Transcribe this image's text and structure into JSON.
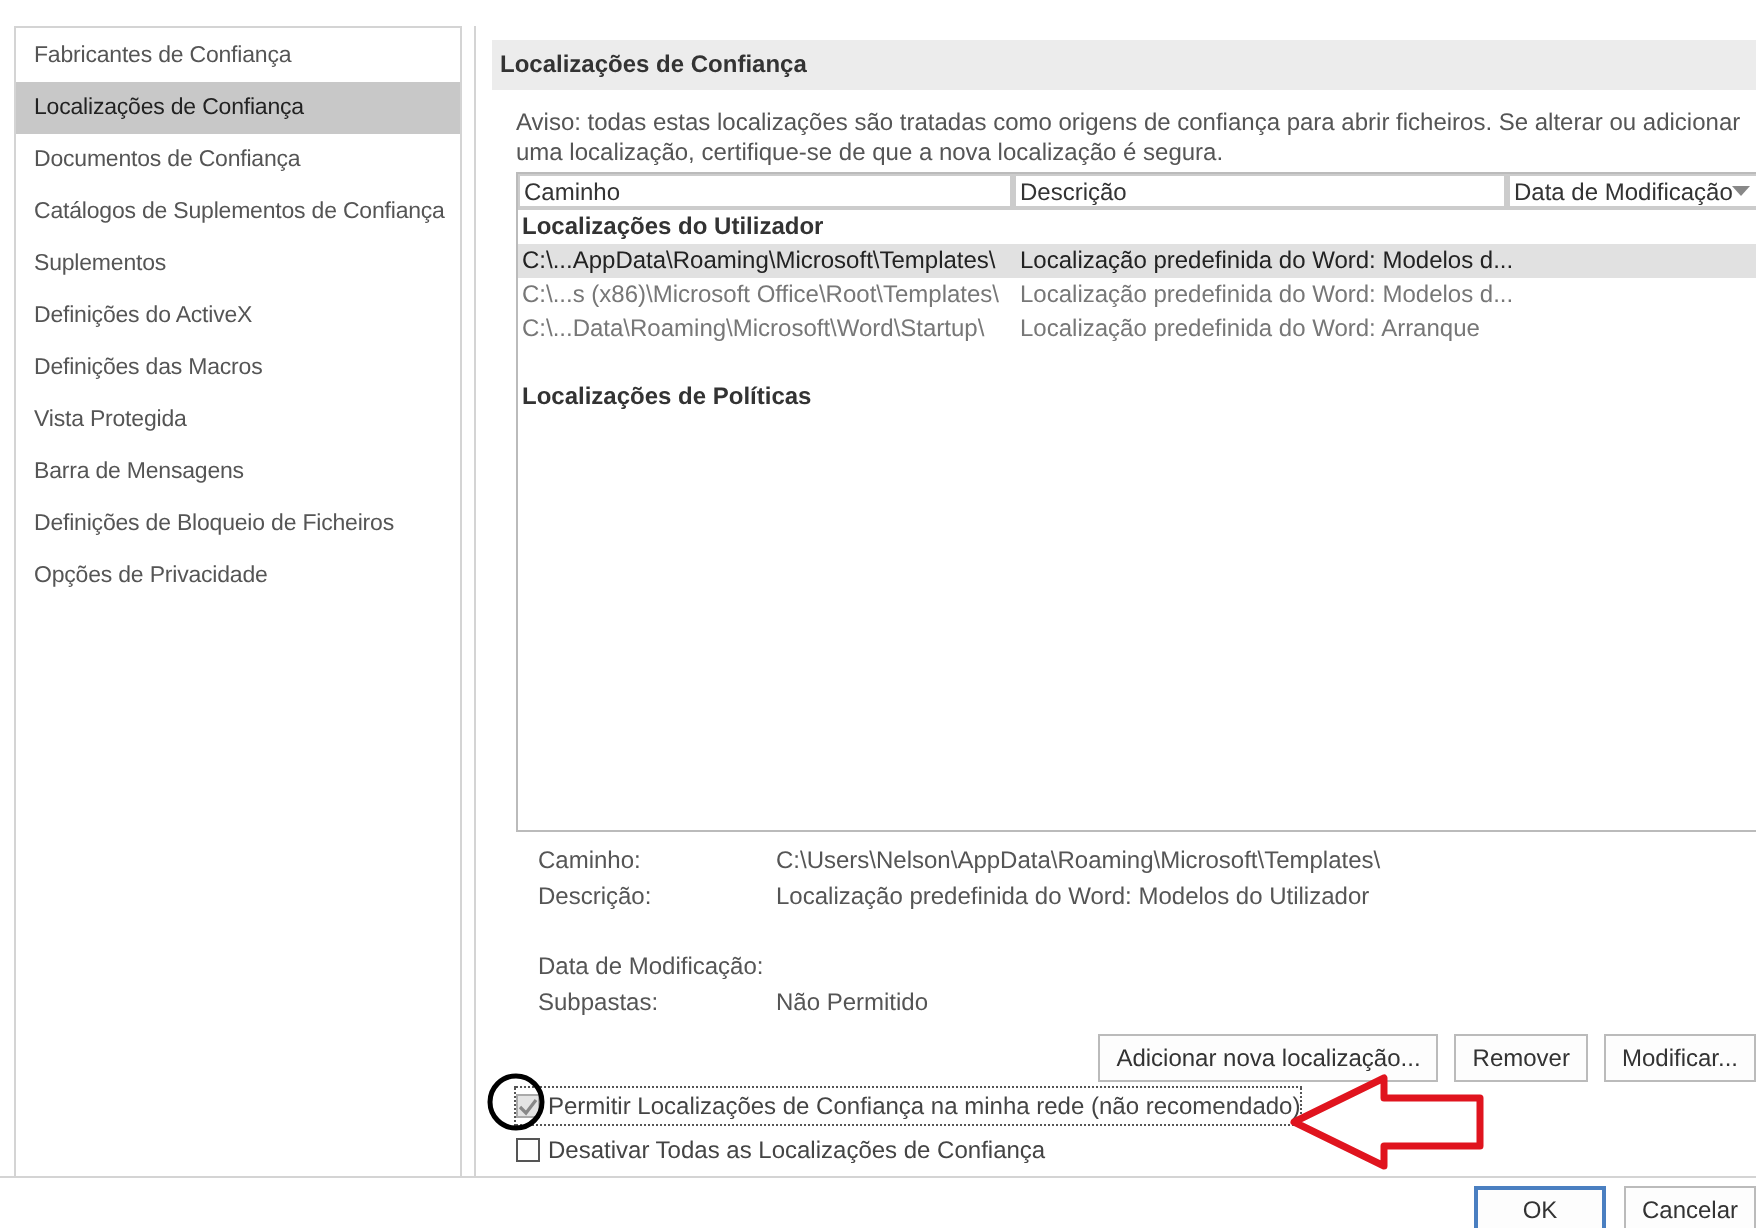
{
  "sidebar": {
    "items": [
      {
        "label": "Fabricantes de Confiança",
        "selected": false
      },
      {
        "label": "Localizações de Confiança",
        "selected": true
      },
      {
        "label": "Documentos de Confiança",
        "selected": false
      },
      {
        "label": "Catálogos de Suplementos de Confiança",
        "selected": false
      },
      {
        "label": "Suplementos",
        "selected": false
      },
      {
        "label": "Definições do ActiveX",
        "selected": false
      },
      {
        "label": "Definições das Macros",
        "selected": false
      },
      {
        "label": "Vista Protegida",
        "selected": false
      },
      {
        "label": "Barra de Mensagens",
        "selected": false
      },
      {
        "label": "Definições de Bloqueio de Ficheiros",
        "selected": false
      },
      {
        "label": "Opções de Privacidade",
        "selected": false
      }
    ]
  },
  "panel": {
    "title": "Localizações de Confiança",
    "warning": "Aviso: todas estas localizações são tratadas como origens de confiança para abrir ficheiros. Se alterar ou adicionar uma localização, certifique-se de que a nova localização é segura.",
    "table": {
      "columns": [
        "Caminho",
        "Descrição",
        "Data de Modificação"
      ],
      "groups": [
        {
          "title": "Localizações do Utilizador",
          "rows": [
            {
              "path": "C:\\...AppData\\Roaming\\Microsoft\\Templates\\",
              "description": "Localização predefinida do Word: Modelos d...",
              "selected": true
            },
            {
              "path": "C:\\...s (x86)\\Microsoft Office\\Root\\Templates\\",
              "description": "Localização predefinida do Word: Modelos d...",
              "selected": false
            },
            {
              "path": "C:\\...Data\\Roaming\\Microsoft\\Word\\Startup\\",
              "description": "Localização predefinida do Word: Arranque",
              "selected": false
            }
          ]
        },
        {
          "title": "Localizações de Políticas"
        }
      ]
    },
    "details": [
      {
        "label": "Caminho:",
        "value": "C:\\Users\\Nelson\\AppData\\Roaming\\Microsoft\\Templates\\"
      },
      {
        "label": "Descrição:",
        "value": "Localização predefinida do Word: Modelos do Utilizador"
      },
      {
        "label": "Data de Modificação:"
      },
      {
        "label": "Subpastas:",
        "value": "Não Permitido"
      }
    ],
    "buttons": [
      "Adicionar nova localização...",
      "Remover",
      "Modificar..."
    ],
    "options": [
      {
        "label": "Permitir Localizações de Confiança na minha rede (não recomendado)",
        "checked": true,
        "disabled": true
      },
      {
        "label": "Desativar Todas as Localizações de Confiança",
        "checked": false,
        "disabled": false
      }
    ]
  },
  "footer": {
    "buttons": [
      "OK",
      "Cancelar"
    ]
  }
}
